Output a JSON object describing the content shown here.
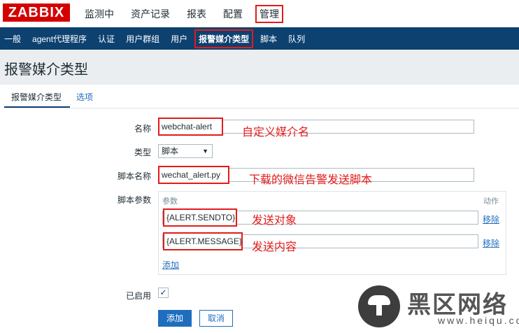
{
  "brand": {
    "logo": "ZABBIX"
  },
  "main_nav": [
    "监测中",
    "资产记录",
    "报表",
    "配置",
    "管理"
  ],
  "sub_nav": [
    "一般",
    "agent代理程序",
    "认证",
    "用户群组",
    "用户",
    "报警媒介类型",
    "脚本",
    "队列"
  ],
  "page": {
    "title": "报警媒介类型"
  },
  "tabs": [
    "报警媒介类型",
    "选项"
  ],
  "form": {
    "name_label": "名称",
    "name_value": "webchat-alert",
    "name_note": "自定义媒介名",
    "type_label": "类型",
    "type_value": "脚本",
    "script_name_label": "脚本名称",
    "script_name_value": "wechat_alert.py",
    "script_name_note": "下载的微信告警发送脚本",
    "script_params_label": "脚本参数",
    "params_header": "参数",
    "actions_header": "动作",
    "params": [
      {
        "value": "{ALERT.SENDTO}",
        "note": "发送对象",
        "remove": "移除"
      },
      {
        "value": "{ALERT.MESSAGE}",
        "note": "发送内容",
        "remove": "移除"
      }
    ],
    "add_link": "添加",
    "enabled_label": "已启用",
    "enabled_check": "✓",
    "add_button": "添加",
    "cancel_button": "取消"
  },
  "watermark": {
    "text": "黑区网络",
    "url": "www.heiqu.com"
  }
}
